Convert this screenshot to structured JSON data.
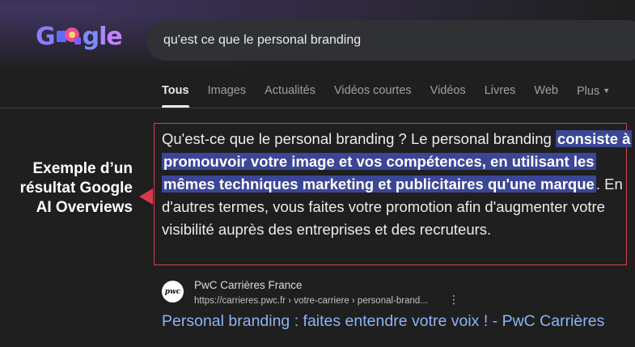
{
  "search": {
    "query": "qu'est ce que le personal branding"
  },
  "logo": {
    "text": "Google"
  },
  "tabs": [
    {
      "label": "Tous",
      "active": true
    },
    {
      "label": "Images"
    },
    {
      "label": "Actualités"
    },
    {
      "label": "Vidéos courtes"
    },
    {
      "label": "Vidéos"
    },
    {
      "label": "Livres"
    },
    {
      "label": "Web"
    },
    {
      "label": "Plus"
    }
  ],
  "callout": {
    "label": "Exemple d’un résultat Google AI Overviews"
  },
  "overview": {
    "part1": "Qu'est-ce que le personal branding ? Le personal branding ",
    "highlight": "consiste à promouvoir votre image et vos compétences, en utilisant les mêmes techniques marketing et publicitaires qu'une marque",
    "part2": ". En d'autres termes, vous faites votre promotion afin d'augmenter votre visibilité auprès des entreprises et des recruteurs."
  },
  "result": {
    "favicon_text": "pwc",
    "site_name": "PwC Carrières France",
    "url": "https://carrieres.pwc.fr › votre-carriere › personal-brand...",
    "title": "Personal branding : faites entendre votre voix ! - PwC Carrières"
  },
  "colors": {
    "background": "#1f1f1f",
    "highlight": "#3b4696",
    "link": "#8ab4f8",
    "callout_red": "#d83a4a"
  }
}
